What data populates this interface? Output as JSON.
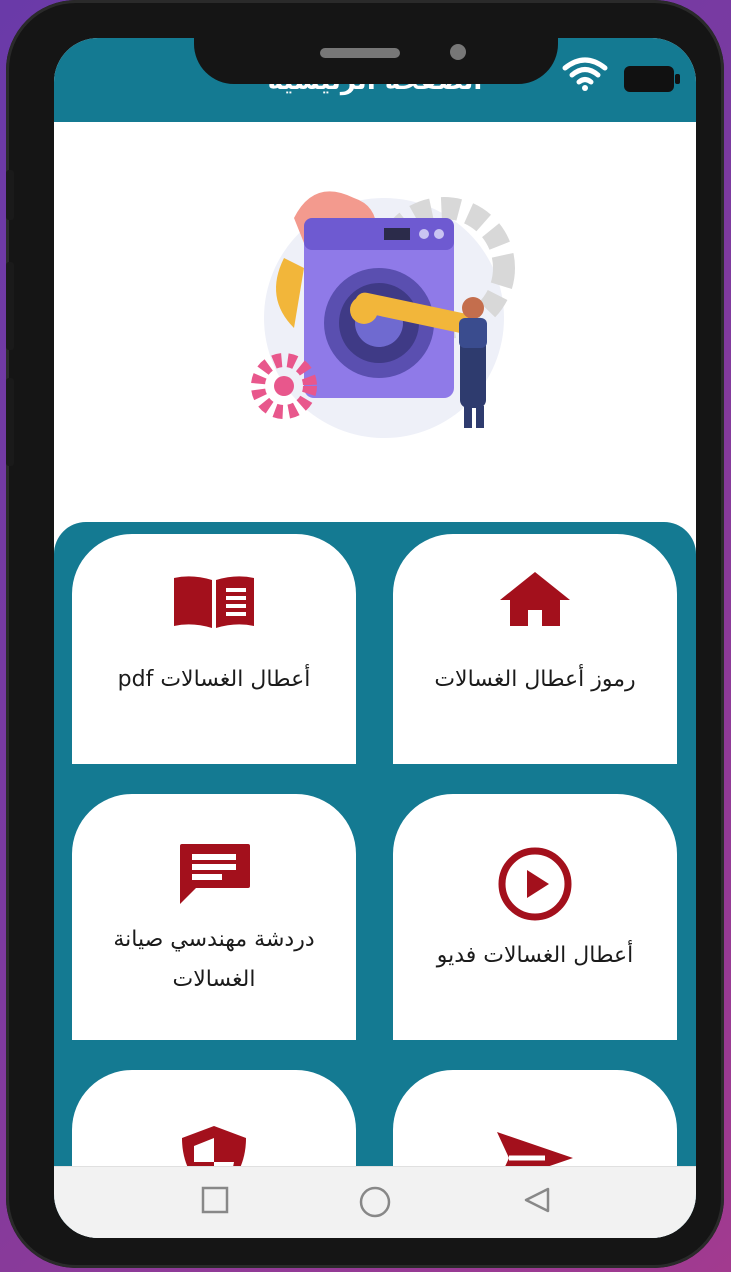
{
  "appbar": {
    "title": "الصفحة الرئيسية"
  },
  "colors": {
    "primary": "#147a92",
    "accent": "#a3101c",
    "card": "#ffffff"
  },
  "menu": [
    {
      "label": "رموز أعطال الغسالات",
      "icon": "home-icon"
    },
    {
      "label": "أعطال الغسالات pdf",
      "icon": "book-icon"
    },
    {
      "label": "أعطال الغسالات فديو",
      "icon": "play-icon"
    },
    {
      "label": "دردشة مهندسي صيانة الغسالات",
      "icon": "chat-icon"
    },
    {
      "label": "",
      "icon": "send-icon"
    },
    {
      "label": "",
      "icon": "shield-icon"
    }
  ],
  "navbar": {
    "back": "back-icon",
    "home": "home-circle-icon",
    "recents": "recents-icon"
  }
}
